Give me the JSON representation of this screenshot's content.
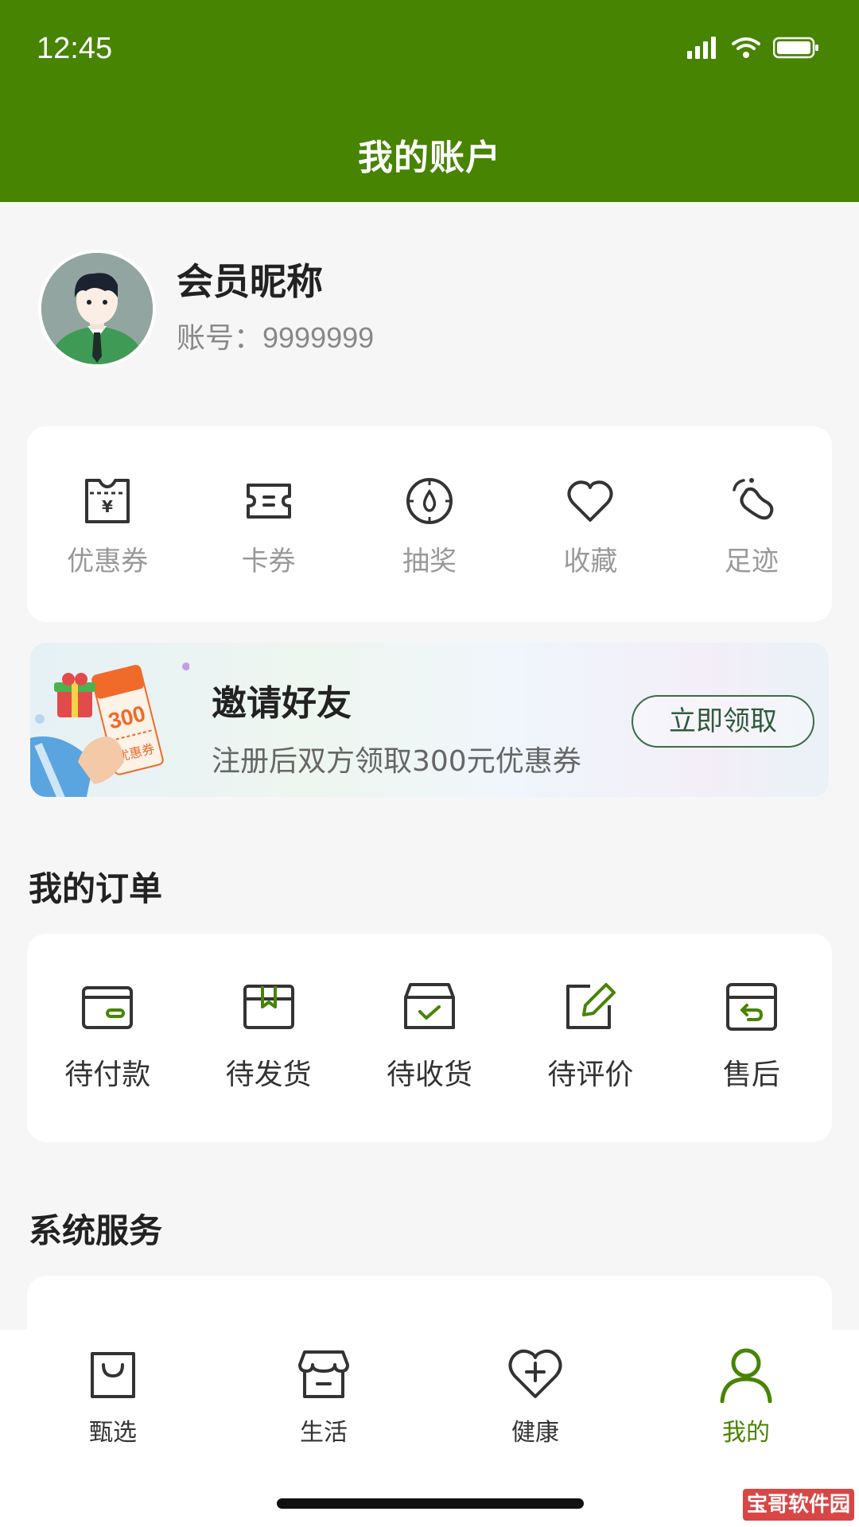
{
  "status_bar": {
    "time": "12:45",
    "icons": [
      "signal-icon",
      "wifi-icon",
      "battery-icon"
    ]
  },
  "header": {
    "title": "我的账户",
    "background": "#478402"
  },
  "profile": {
    "nickname": "会员昵称",
    "account_label": "账号：",
    "account_number": "9999999"
  },
  "quick_actions": [
    {
      "label": "优惠券",
      "icon": "coupon-icon"
    },
    {
      "label": "卡券",
      "icon": "ticket-icon"
    },
    {
      "label": "抽奖",
      "icon": "lottery-icon"
    },
    {
      "label": "收藏",
      "icon": "heart-icon"
    },
    {
      "label": "足迹",
      "icon": "footprint-icon"
    }
  ],
  "invite_banner": {
    "title": "邀请好友",
    "subtitle": "注册后双方领取300元优惠券",
    "button": "立即领取",
    "ticket_value": "300",
    "ticket_text": "优惠券"
  },
  "orders": {
    "title": "我的订单",
    "items": [
      {
        "label": "待付款",
        "icon": "wallet-icon"
      },
      {
        "label": "待发货",
        "icon": "box-icon"
      },
      {
        "label": "待收货",
        "icon": "box-check-icon"
      },
      {
        "label": "待评价",
        "icon": "edit-icon"
      },
      {
        "label": "售后",
        "icon": "return-box-icon"
      }
    ]
  },
  "services": {
    "title": "系统服务"
  },
  "tabbar": {
    "active_color": "#478402",
    "items": [
      {
        "label": "甄选",
        "icon": "shopping-bag-icon",
        "active": false
      },
      {
        "label": "生活",
        "icon": "store-icon",
        "active": false
      },
      {
        "label": "健康",
        "icon": "health-heart-icon",
        "active": false
      },
      {
        "label": "我的",
        "icon": "user-icon",
        "active": true
      }
    ]
  },
  "watermark": "宝哥软件园"
}
